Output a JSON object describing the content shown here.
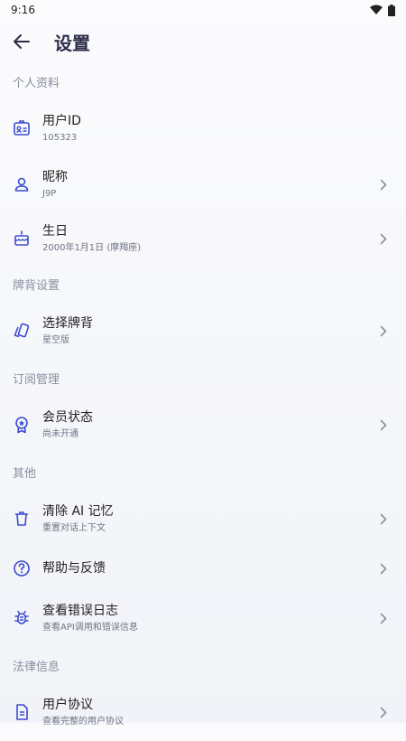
{
  "status": {
    "time": "9:16"
  },
  "header": {
    "title": "设置"
  },
  "colors": {
    "accent": "#3b4bd0",
    "subtle": "#8a8fa0"
  },
  "sections": {
    "profile": {
      "title": "个人资料",
      "user_id": {
        "label": "用户ID",
        "value": "105323",
        "icon": "id-card-icon"
      },
      "nickname": {
        "label": "昵称",
        "value": "J9P",
        "icon": "person-icon"
      },
      "birthday": {
        "label": "生日",
        "value": "2000年1月1日 (摩羯座)",
        "icon": "cake-icon"
      }
    },
    "card_back": {
      "title": "牌背设置",
      "choose": {
        "label": "选择牌背",
        "value": "星空版",
        "icon": "cards-icon"
      }
    },
    "subscription": {
      "title": "订阅管理",
      "membership": {
        "label": "会员状态",
        "value": "尚未开通",
        "icon": "badge-icon"
      }
    },
    "other": {
      "title": "其他",
      "clear_ai": {
        "label": "清除 AI 记忆",
        "value": "重置对话上下文",
        "icon": "trash-icon"
      },
      "help": {
        "label": "帮助与反馈",
        "icon": "help-icon"
      },
      "logs": {
        "label": "查看错误日志",
        "value": "查看API调用和错误信息",
        "icon": "bug-icon"
      }
    },
    "legal": {
      "title": "法律信息",
      "agreement": {
        "label": "用户协议",
        "value": "查看完整的用户协议",
        "icon": "document-icon"
      }
    }
  }
}
